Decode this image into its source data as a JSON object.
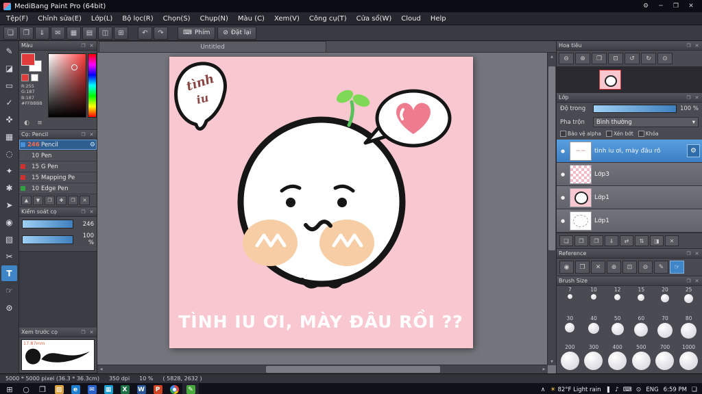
{
  "ui": {
    "float_glyph": "❐",
    "close_glyph": "✕",
    "dropdown_arrow": "▾",
    "gear_glyph": "⚙",
    "visibility_glyph": "●",
    "scroll_up": "▲",
    "scroll_down": "▼",
    "scroll_left": "◀",
    "scroll_right": "▶"
  },
  "window": {
    "title": "MediBang Paint Pro (64bit)",
    "controls": [
      {
        "id": "settings",
        "glyph": "⚙"
      },
      {
        "id": "minimize",
        "glyph": "─"
      },
      {
        "id": "maximize",
        "glyph": "❐"
      },
      {
        "id": "close",
        "glyph": "✕"
      }
    ]
  },
  "menubar": {
    "items": [
      "Tệp(F)",
      "Chỉnh sửa(E)",
      "Lớp(L)",
      "Bộ lọc(R)",
      "Chọn(S)",
      "Chụp(N)",
      "Màu (C)",
      "Xem(V)",
      "Công cụ(T)",
      "Cửa sổ(W)",
      "Cloud",
      "Help"
    ]
  },
  "toolbar": {
    "file_icons": [
      {
        "id": "new-file",
        "glyph": "❏"
      },
      {
        "id": "open-file",
        "glyph": "❒"
      },
      {
        "id": "save-file",
        "glyph": "⇓"
      },
      {
        "id": "publish",
        "glyph": "✉"
      },
      {
        "id": "color-window",
        "glyph": "▦"
      },
      {
        "id": "material-window",
        "glyph": "▤"
      },
      {
        "id": "split-view",
        "glyph": "◫"
      },
      {
        "id": "snap-grid",
        "glyph": "⊞"
      }
    ],
    "history_icons": [
      {
        "id": "undo",
        "glyph": "↶"
      },
      {
        "id": "redo",
        "glyph": "↷"
      }
    ],
    "keys_button": "Phím",
    "reset_button": "Đặt lại",
    "keyboard_glyph": "⌨",
    "reset_glyph": "⊘"
  },
  "tools": [
    {
      "id": "pen",
      "glyph": "✎"
    },
    {
      "id": "eraser",
      "glyph": "◪"
    },
    {
      "id": "shape",
      "glyph": "▭"
    },
    {
      "id": "select-pen",
      "glyph": "✓"
    },
    {
      "id": "move",
      "glyph": "✜"
    },
    {
      "id": "rect-select",
      "glyph": "▦"
    },
    {
      "id": "lasso",
      "glyph": "◌"
    },
    {
      "id": "magic-wand",
      "glyph": "✦"
    },
    {
      "id": "auto-select",
      "glyph": "✱"
    },
    {
      "id": "operation",
      "glyph": "➤"
    },
    {
      "id": "fill",
      "glyph": "◉"
    },
    {
      "id": "gradient",
      "glyph": "▧"
    },
    {
      "id": "slice",
      "glyph": "✂"
    },
    {
      "id": "text",
      "glyph": "T"
    },
    {
      "id": "hand",
      "glyph": "☞"
    },
    {
      "id": "zoom",
      "glyph": "⊙"
    }
  ],
  "active_tool_index": 13,
  "color_panel": {
    "title": "Màu",
    "r_label": "R:255",
    "g_label": "G:187",
    "b_label": "B:187",
    "hex_label": "#FFBBBB",
    "foreground_color": "#e23b3b",
    "background_color": "#ffffff",
    "footer_icons": [
      {
        "id": "color-wheel",
        "glyph": "◐"
      },
      {
        "id": "color-sliders",
        "glyph": "≡"
      }
    ]
  },
  "brush_panel": {
    "title": "Cọ: Pencil",
    "brushes": [
      {
        "size": "246",
        "name": "Pencil",
        "tag": "#4a90d9",
        "selected": true
      },
      {
        "size": "10",
        "name": "Pen",
        "tag": "#50505a",
        "selected": false
      },
      {
        "size": "15",
        "name": "G Pen",
        "tag": "#d03030",
        "selected": false
      },
      {
        "size": "15",
        "name": "Mapping Pe",
        "tag": "#d03030",
        "selected": false
      },
      {
        "size": "10",
        "name": "Edge Pen",
        "tag": "#30a040",
        "selected": false
      }
    ],
    "footer_icons": [
      {
        "id": "brush-up",
        "glyph": "▲"
      },
      {
        "id": "brush-down",
        "glyph": "▼"
      },
      {
        "id": "brush-folder",
        "glyph": "❒"
      },
      {
        "id": "add-brush",
        "glyph": "✚"
      },
      {
        "id": "duplicate-brush",
        "glyph": "❐"
      },
      {
        "id": "delete-brush",
        "glyph": "✕"
      }
    ]
  },
  "brush_control": {
    "title": "Kiểm soát cọ",
    "rows": [
      {
        "value": "246"
      },
      {
        "value": "100 %"
      }
    ]
  },
  "brush_preview": {
    "title": "Xem trước cọ",
    "size_label": "17.87mm"
  },
  "canvas": {
    "tab_title": "Untitled",
    "bg_color": "#F9C7D0",
    "bubble_line1": "tình",
    "bubble_line2": "iu",
    "caption": "TÌNH IU ƠI, MÀY ĐÂU RỒI ??"
  },
  "navigator": {
    "title": "Hoa tiêu",
    "toolbar": [
      {
        "id": "zoom-out",
        "glyph": "⊖"
      },
      {
        "id": "zoom-in",
        "glyph": "⊕"
      },
      {
        "id": "fit-window",
        "glyph": "❒"
      },
      {
        "id": "actual-size",
        "glyph": "⊡"
      },
      {
        "id": "rotate-left",
        "glyph": "↺"
      },
      {
        "id": "rotate-right",
        "glyph": "↻"
      },
      {
        "id": "reset-view",
        "glyph": "⊙"
      }
    ]
  },
  "layers_panel": {
    "title": "Lớp",
    "opacity_label": "Độ trong",
    "opacity_value": "100 %",
    "blend_label": "Pha trộn",
    "blend_value": "Bình thường",
    "protect_alpha_label": "Bảo vệ alpha",
    "clipping_label": "Xén bớt",
    "lock_label": "Khóa",
    "layers": [
      {
        "name": "tình iu ơi, mày đâu rồ",
        "selected": true,
        "thumb": "text"
      },
      {
        "name": "Lớp3",
        "selected": false,
        "thumb": "pink"
      },
      {
        "name": "Lớp1",
        "selected": false,
        "thumb": "art"
      },
      {
        "name": "Lớp1",
        "selected": false,
        "thumb": "sketch"
      }
    ],
    "footer_icons": [
      {
        "id": "new-layer",
        "glyph": "❏"
      },
      {
        "id": "new-folder",
        "glyph": "❒"
      },
      {
        "id": "duplicate-layer",
        "glyph": "❐"
      },
      {
        "id": "merge-down",
        "glyph": "⇓"
      },
      {
        "id": "transfer-layer",
        "glyph": "⇄"
      },
      {
        "id": "reorder-layer",
        "glyph": "⇅"
      },
      {
        "id": "layer-mask",
        "glyph": "◨"
      },
      {
        "id": "delete-layer",
        "glyph": "✕"
      }
    ]
  },
  "reference_panel": {
    "title": "Reference",
    "toolbar": [
      {
        "id": "capture-image",
        "glyph": "◉",
        "active": false
      },
      {
        "id": "open-image",
        "glyph": "❒",
        "active": false
      },
      {
        "id": "close-image",
        "glyph": "✕",
        "active": false
      },
      {
        "id": "ref-zoom-in",
        "glyph": "⊕",
        "active": false
      },
      {
        "id": "ref-fit",
        "glyph": "⊡",
        "active": false
      },
      {
        "id": "ref-zoom-out",
        "glyph": "⊖",
        "active": false
      },
      {
        "id": "ref-picker",
        "glyph": "✎",
        "active": false
      },
      {
        "id": "ref-hand",
        "glyph": "☞",
        "active": true
      }
    ]
  },
  "brush_size_panel": {
    "title": "Brush Size",
    "rows": [
      {
        "labels": [
          "7",
          "10",
          "12",
          "15",
          "20",
          "25"
        ]
      },
      {
        "labels": [
          "30",
          "40",
          "50",
          "60",
          "70",
          "80"
        ]
      },
      {
        "labels": [
          "200",
          "300",
          "400",
          "500",
          "700",
          "1000"
        ]
      }
    ]
  },
  "statusbar": {
    "size": "5000 * 5000 pixel  (36.3 * 36.3cm)",
    "dpi": "350 dpi",
    "zoom": "10 %",
    "coords": "( 5828, 2632 )"
  },
  "taskbar": {
    "system": [
      {
        "id": "start",
        "glyph": "⊞"
      },
      {
        "id": "search",
        "glyph": "○"
      },
      {
        "id": "task-view",
        "glyph": "❐"
      }
    ],
    "apps": [
      {
        "id": "folder",
        "glyph": "▨",
        "color": "#d9a441",
        "active": false
      },
      {
        "id": "edge",
        "glyph": "e",
        "color": "#1e7fd0",
        "active": false
      },
      {
        "id": "mail",
        "glyph": "✉",
        "color": "#2a62c9",
        "active": false
      },
      {
        "id": "photos",
        "glyph": "▦",
        "color": "#1b9fd0",
        "active": false
      },
      {
        "id": "excel",
        "glyph": "X",
        "color": "#1e7145",
        "active": false
      },
      {
        "id": "word",
        "glyph": "W",
        "color": "#2b579a",
        "active": false
      },
      {
        "id": "powerpoint",
        "glyph": "P",
        "color": "#d04423",
        "active": false
      },
      {
        "id": "chrome",
        "glyph": "",
        "color": "",
        "active": false
      },
      {
        "id": "medibang",
        "glyph": "✎",
        "color": "#4aa93c",
        "active": true
      }
    ],
    "tray_expand_glyph": "∧",
    "weather_icon": "☀",
    "weather": "82°F Light rain",
    "tray_icons": [
      {
        "id": "display",
        "glyph": "❚"
      },
      {
        "id": "volume",
        "glyph": "♪"
      },
      {
        "id": "touch-keyboard",
        "glyph": "⌨"
      },
      {
        "id": "network",
        "glyph": "⊙"
      }
    ],
    "language": "ENG",
    "time": "6:59 PM",
    "notification_glyph": "❏"
  }
}
